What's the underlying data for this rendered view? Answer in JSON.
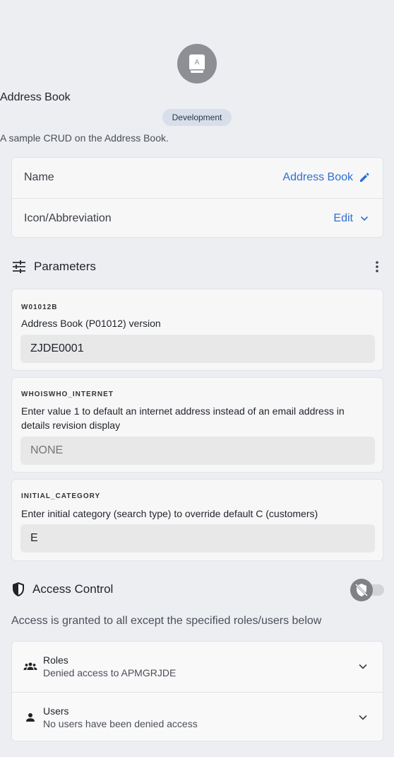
{
  "app": {
    "icon_letter": "A",
    "title": "Address Book",
    "badge": "Development",
    "description": "A sample CRUD on the Address Book."
  },
  "properties": {
    "name_label": "Name",
    "name_value": "Address Book",
    "icon_label": "Icon/Abbreviation",
    "icon_value": "Edit"
  },
  "parameters": {
    "title": "Parameters",
    "items": [
      {
        "name": "W01012B",
        "description": "Address Book (P01012) version",
        "value": "ZJDE0001",
        "placeholder": ""
      },
      {
        "name": "WHOISWHO_INTERNET",
        "description": "Enter value 1 to default an internet address instead of an email address in details revision display",
        "value": "",
        "placeholder": "NONE"
      },
      {
        "name": "INITIAL_CATEGORY",
        "description": "Enter initial category (search type) to override default C (customers)",
        "value": "E",
        "placeholder": ""
      }
    ]
  },
  "access": {
    "title": "Access Control",
    "note": "Access is granted to all except the specified roles/users below",
    "enabled": false,
    "roles_title": "Roles",
    "roles_sub": "Denied access to APMGRJDE",
    "users_title": "Users",
    "users_sub": "No users have been denied access"
  },
  "colors": {
    "accent": "#2f6fd1",
    "background": "#eceef2",
    "card": "#f7f7f8"
  }
}
